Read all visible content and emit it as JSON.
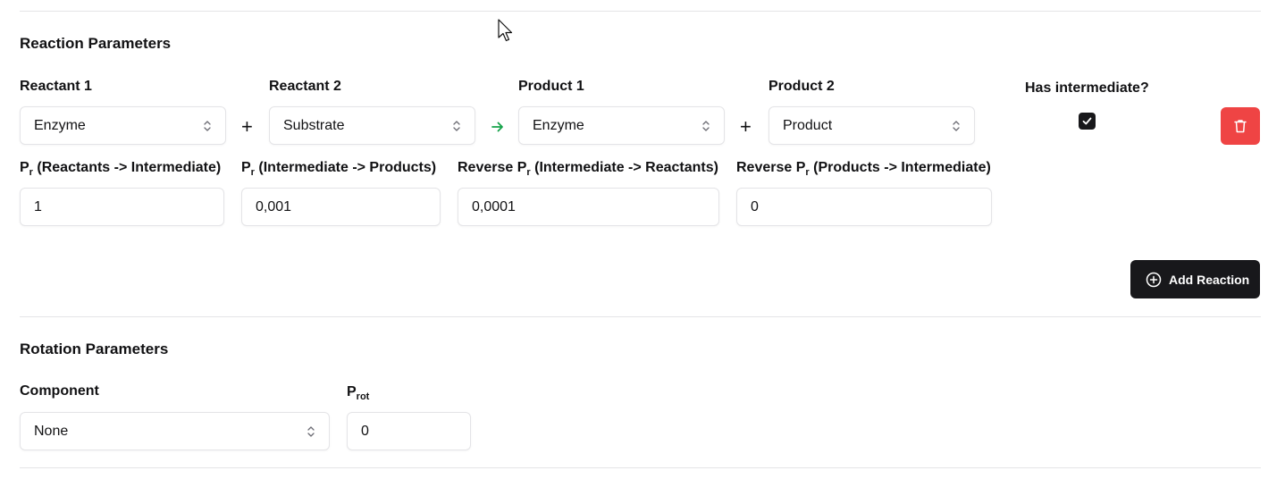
{
  "reaction": {
    "title": "Reaction Parameters",
    "reactant1": {
      "label": "Reactant 1",
      "value": "Enzyme"
    },
    "reactant2": {
      "label": "Reactant 2",
      "value": "Substrate"
    },
    "product1": {
      "label": "Product 1",
      "value": "Enzyme"
    },
    "product2": {
      "label": "Product 2",
      "value": "Product"
    },
    "plus_symbol": "+",
    "has_intermediate": {
      "label": "Has intermediate?",
      "checked": true
    },
    "rates": [
      {
        "label_prefix": "P",
        "label_sub": "r",
        "label_suffix": " (Reactants -> Intermediate)",
        "value": "1"
      },
      {
        "label_prefix": "P",
        "label_sub": "r",
        "label_suffix": " (Intermediate -> Products)",
        "value": "0,001"
      },
      {
        "label_prefix": "Reverse P",
        "label_sub": "r",
        "label_suffix": " (Intermediate -> Reactants)",
        "value": "0,0001"
      },
      {
        "label_prefix": "Reverse P",
        "label_sub": "r",
        "label_suffix": " (Products -> Intermediate)",
        "value": "0"
      }
    ],
    "add_button": "Add Reaction"
  },
  "rotation": {
    "title": "Rotation Parameters",
    "component": {
      "label": "Component",
      "value": "None"
    },
    "prot": {
      "label_prefix": "P",
      "label_sub": "rot",
      "value": "0"
    }
  },
  "colors": {
    "accent_dark": "#18181b",
    "delete_red": "#ef4444",
    "arrow_green": "#16a34a",
    "border": "#e4e4e7"
  },
  "icons": {
    "chevrons": "chevrons-up-down-icon",
    "arrow": "arrow-right-icon",
    "check": "check-icon",
    "trash": "trash-icon",
    "add": "plus-circle-icon",
    "cursor": "mouse-cursor-icon"
  }
}
